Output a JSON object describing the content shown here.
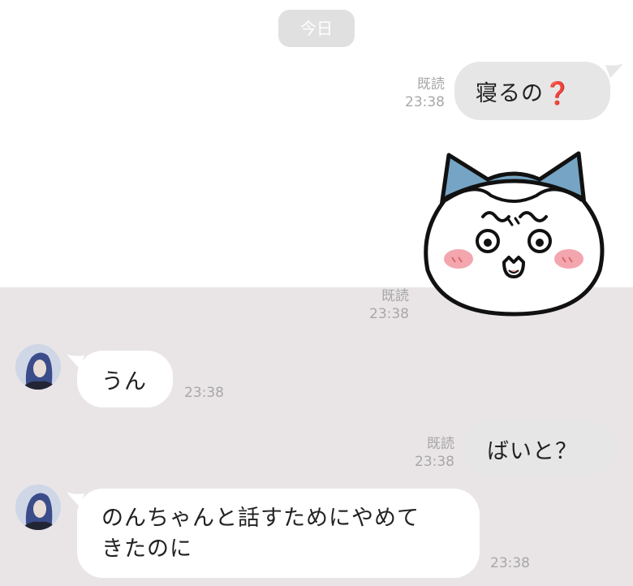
{
  "date_divider": "今日",
  "messages": [
    {
      "type": "text",
      "direction": "out",
      "text": "寝るの",
      "suffix_icon": "red-question-mark",
      "read": "既読",
      "time": "23:38"
    },
    {
      "type": "sticker",
      "direction": "out",
      "sticker": "white-cat-blue-ears-sticker",
      "read": "既読",
      "time": "23:38"
    },
    {
      "type": "text",
      "direction": "in",
      "text": "うん",
      "time": "23:38"
    },
    {
      "type": "text",
      "direction": "out",
      "text": "ばいと？",
      "read": "既読",
      "time": "23:38"
    },
    {
      "type": "text",
      "direction": "in",
      "text_line1": "のんちゃんと話すためにやめて",
      "text_line2": "きたのに",
      "time": "23:38"
    }
  ],
  "icons": {
    "question": "❓"
  },
  "colors": {
    "out_bubble": "#e6e6e6",
    "in_bubble": "#ffffff",
    "chat_bg_lower": "#e9e5e6",
    "accent_question": "#d40b0b"
  }
}
